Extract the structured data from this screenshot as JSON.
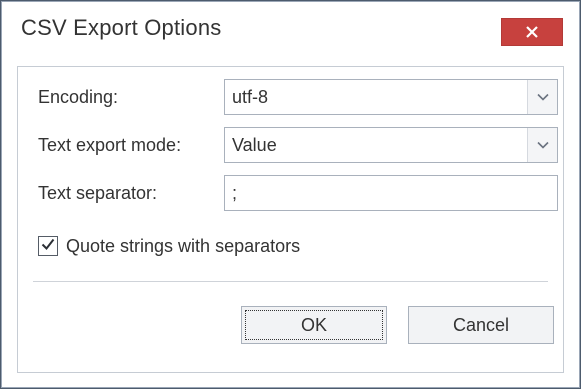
{
  "dialog": {
    "title": "CSV Export Options",
    "close_icon": "close-icon",
    "colors": {
      "close_button_bg": "#c7413e",
      "text": "#333333"
    }
  },
  "fields": {
    "encoding": {
      "label": "Encoding:",
      "value": "utf-8"
    },
    "text_export_mode": {
      "label": "Text export mode:",
      "value": "Value"
    },
    "text_separator": {
      "label": "Text separator:",
      "value": ";"
    }
  },
  "options": {
    "quote_strings": {
      "label": "Quote strings with separators",
      "checked": true
    }
  },
  "buttons": {
    "ok": "OK",
    "cancel": "Cancel"
  }
}
